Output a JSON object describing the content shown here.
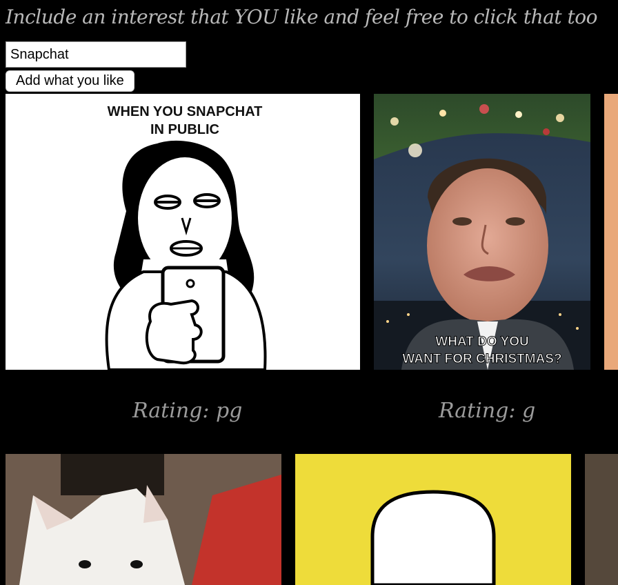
{
  "header": {
    "title": "Include an interest that YOU like and feel free to click that too"
  },
  "search": {
    "value": "Snapchat",
    "add_button_label": "Add what you like"
  },
  "results": {
    "row1": [
      {
        "caption_line1": "WHEN YOU SNAPCHAT",
        "caption_line2": "IN PUBLIC",
        "rating": "Rating: pg"
      },
      {
        "caption_line1": "WHAT DO YOU",
        "caption_line2": "WANT FOR CHRISTMAS?",
        "rating": "Rating: g"
      }
    ]
  },
  "colors": {
    "background": "#000000",
    "text_muted": "#9b9b9b",
    "snapchat_yellow": "#eedc3a"
  }
}
